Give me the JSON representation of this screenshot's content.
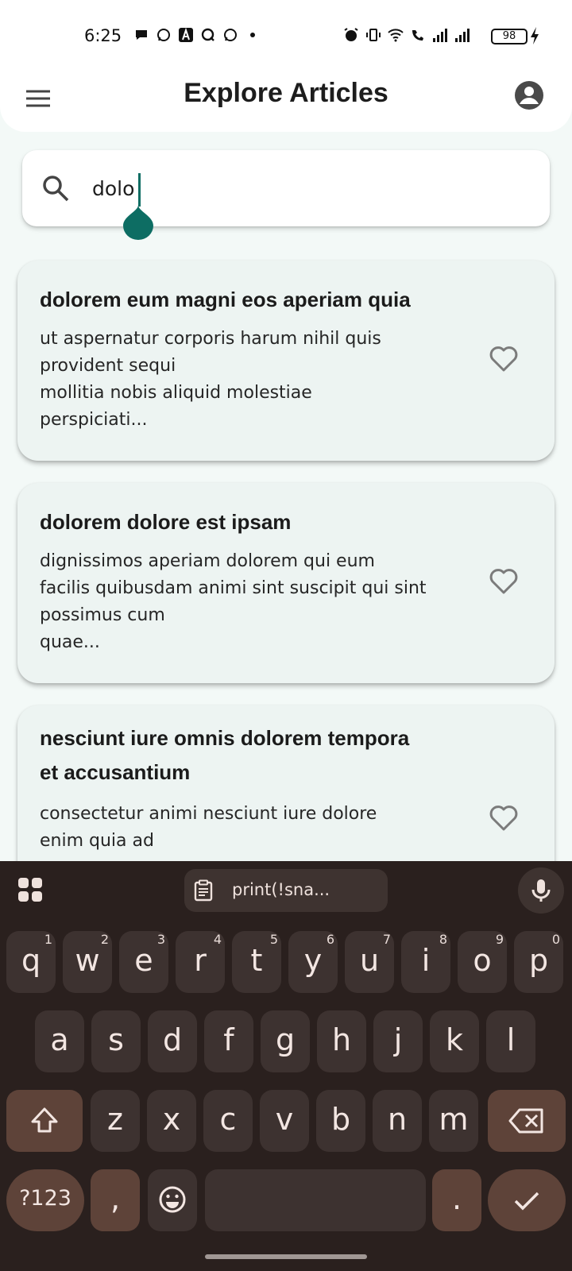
{
  "status_bar": {
    "time": "6:25",
    "battery": "98"
  },
  "app_bar": {
    "title": "Explore Articles"
  },
  "search": {
    "value": "dolo",
    "accent_color": "#0d6d63"
  },
  "articles": [
    {
      "title": "dolorem eum magni eos aperiam quia",
      "body": "ut aspernatur corporis harum nihil quis\nprovident sequi\nmollitia nobis aliquid molestiae\nperspiciati..."
    },
    {
      "title": "dolorem dolore est ipsam",
      "body": "dignissimos aperiam dolorem qui eum\nfacilis quibusdam animi sint suscipit qui sint\npossimus cum\nquae..."
    },
    {
      "title": "nesciunt iure omnis dolorem tempora\net accusantium",
      "body": "consectetur animi nesciunt iure dolore\nenim quia ad"
    }
  ],
  "keyboard": {
    "clipboard_suggestion": "print(!sna...",
    "row1": [
      {
        "key": "q",
        "hint": "1"
      },
      {
        "key": "w",
        "hint": "2"
      },
      {
        "key": "e",
        "hint": "3"
      },
      {
        "key": "r",
        "hint": "4"
      },
      {
        "key": "t",
        "hint": "5"
      },
      {
        "key": "y",
        "hint": "6"
      },
      {
        "key": "u",
        "hint": "7"
      },
      {
        "key": "i",
        "hint": "8"
      },
      {
        "key": "o",
        "hint": "9"
      },
      {
        "key": "p",
        "hint": "0"
      }
    ],
    "row2": [
      "a",
      "s",
      "d",
      "f",
      "g",
      "h",
      "j",
      "k",
      "l"
    ],
    "row3": [
      "z",
      "x",
      "c",
      "v",
      "b",
      "n",
      "m"
    ],
    "symbols_label": "?123",
    "comma": ",",
    "period": "."
  },
  "colors": {
    "background": "#f3f9f7",
    "card": "#edf4f2",
    "keyboard_bg": "#2a201e",
    "key": "#3d3230",
    "special_key": "#5e4339"
  }
}
